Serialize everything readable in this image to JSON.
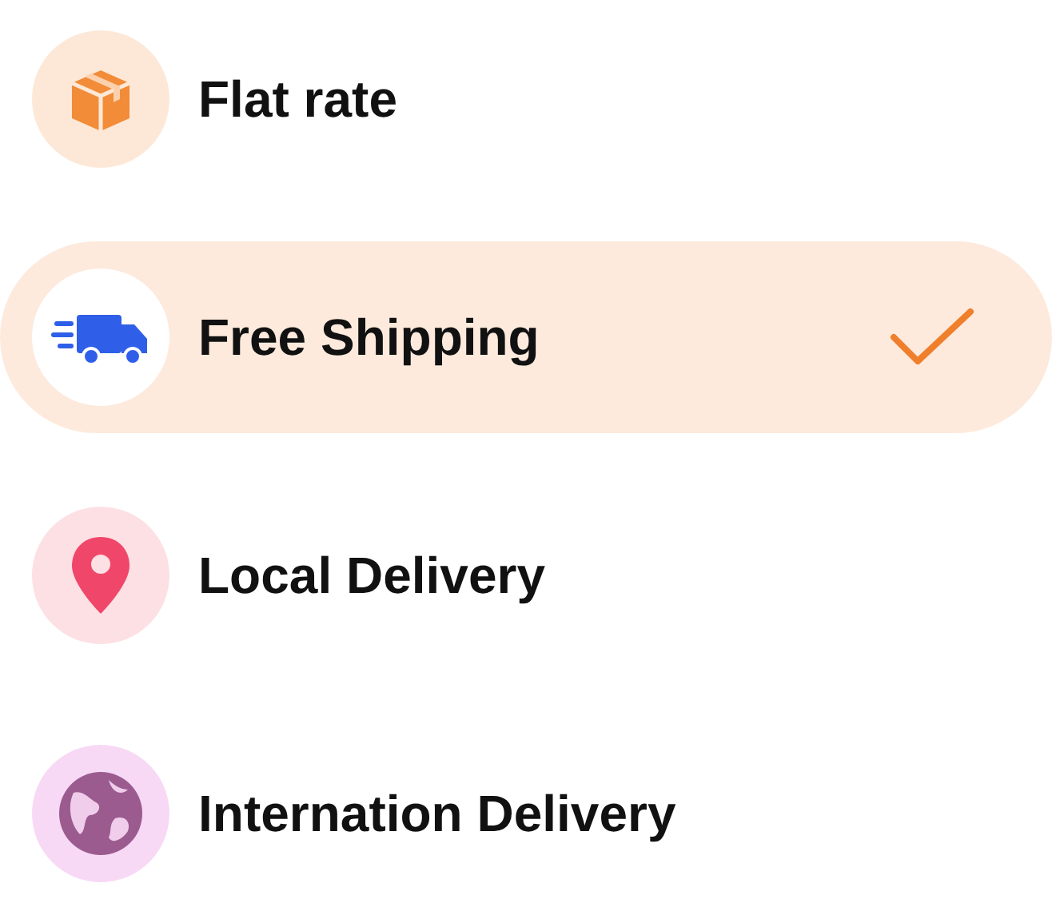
{
  "options": [
    {
      "kind": "box",
      "label": "Flat rate",
      "color": "#fde8d7",
      "selected": false
    },
    {
      "kind": "truck",
      "label": "Free Shipping",
      "color": "#ffffff",
      "selected": true
    },
    {
      "kind": "pin",
      "label": "Local Delivery",
      "color": "#fde0e4",
      "selected": false
    },
    {
      "kind": "globe",
      "label": "Internation Delivery",
      "color": "#f8d9f5",
      "selected": false
    }
  ]
}
